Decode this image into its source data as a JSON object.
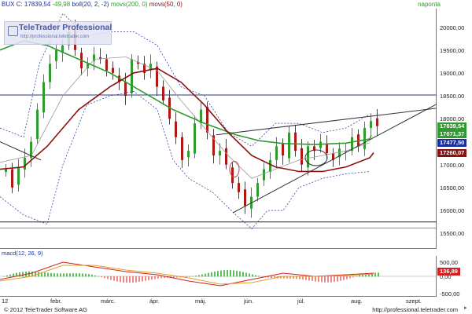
{
  "header": {
    "symbol": "BUX",
    "close_label": "C: 17839,54",
    "change": "-49,98",
    "boll": "boll(20, 2, -2)",
    "ma200": "movs(200, 0)",
    "ma50": "movs(50, 0)",
    "period": "napontа"
  },
  "logo": {
    "title": "TeleTrader Professional",
    "url": "http://professional.teletrader.com"
  },
  "price_axis": {
    "labels": [
      "20000,00",
      "19500,00",
      "19000,00",
      "18500,00",
      "18000,00",
      "17500,00",
      "17000,00",
      "16500,00",
      "16000,00",
      "15500,00"
    ],
    "tags": [
      {
        "text": "17839,54",
        "color": "#2e9c2e"
      },
      {
        "text": "17671,37",
        "color": "#2e9c2e"
      },
      {
        "text": "17477,50",
        "color": "#1a2f9a"
      },
      {
        "text": "17260,07",
        "color": "#8a1010"
      }
    ]
  },
  "macd": {
    "title": "macd(12, 26, 9)",
    "axis_labels": [
      "500,00",
      "0,00",
      "-500,00"
    ],
    "tag": "136,89"
  },
  "x_axis": {
    "labels": [
      "12",
      "febr.",
      "márc.",
      "ápr.",
      "máj.",
      "jún.",
      "júl.",
      "aug.",
      "szept."
    ]
  },
  "footer": {
    "copyright": "© 2012 TeleTrader Software AG",
    "url": "http://professional.teletrader.com"
  },
  "colors": {
    "up_candle": "#2e9c2e",
    "down_candle": "#b01818",
    "ma200": "#2e9c2e",
    "ma50": "#8a1010",
    "bollinger": "#1a2f9a",
    "trendline": "#333333"
  },
  "chart_data": {
    "type": "candlestick",
    "ylim": [
      15300,
      20300
    ],
    "series": [
      {
        "name": "movs(200, 0)",
        "values": [
          18940,
          18200,
          17700,
          17470,
          17500,
          17640
        ]
      },
      {
        "name": "movs(50, 0)",
        "values": [
          16800,
          18000,
          18800,
          18300,
          17100,
          17260
        ]
      }
    ],
    "closes": [
      16950,
      16700,
      17600,
      18900,
      19900,
      19300,
      19100,
      19000,
      18800,
      19400,
      18800,
      18500,
      18000,
      17100,
      16300,
      16100,
      17000,
      17500,
      17200,
      17400,
      17200,
      17300,
      17700,
      17839.54
    ],
    "horizontal_lines": [
      18520,
      15750,
      15650
    ]
  }
}
